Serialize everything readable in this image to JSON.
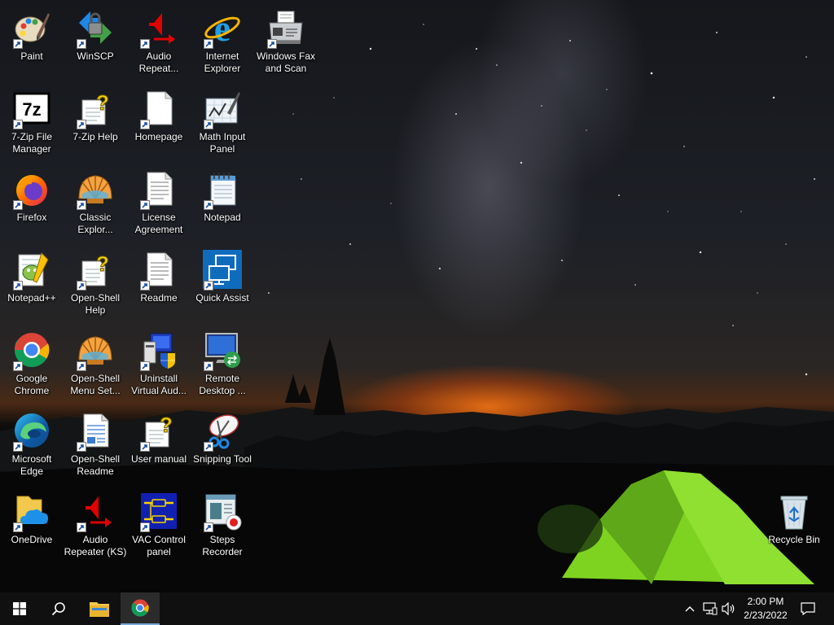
{
  "desktop": {
    "icons": [
      {
        "label": "Paint",
        "icon": "paint-icon"
      },
      {
        "label": "WinSCP",
        "icon": "winscp-icon"
      },
      {
        "label": "Audio Repeat...",
        "icon": "audio-repeater-icon"
      },
      {
        "label": "Internet Explorer",
        "icon": "internet-explorer-icon"
      },
      {
        "label": "Windows Fax and Scan",
        "icon": "fax-scan-icon"
      },
      {
        "label": "7-Zip File Manager",
        "icon": "7zip-icon"
      },
      {
        "label": "7-Zip Help",
        "icon": "help-file-icon"
      },
      {
        "label": "Homepage",
        "icon": "blank-document-icon"
      },
      {
        "label": "Math Input Panel",
        "icon": "math-input-icon"
      },
      {
        "label": "Firefox",
        "icon": "firefox-icon"
      },
      {
        "label": "Classic Explor...",
        "icon": "open-shell-icon"
      },
      {
        "label": "License Agreement",
        "icon": "text-document-icon"
      },
      {
        "label": "Notepad",
        "icon": "notepad-icon"
      },
      {
        "label": "Notepad++",
        "icon": "notepad-plus-plus-icon"
      },
      {
        "label": "Open-Shell Help",
        "icon": "help-file-icon"
      },
      {
        "label": "Readme",
        "icon": "text-document-icon"
      },
      {
        "label": "Quick Assist",
        "icon": "quick-assist-icon"
      },
      {
        "label": "Google Chrome",
        "icon": "chrome-icon"
      },
      {
        "label": "Open-Shell Menu Set...",
        "icon": "open-shell-icon"
      },
      {
        "label": "Uninstall Virtual Aud...",
        "icon": "uninstall-icon"
      },
      {
        "label": "Remote Desktop ...",
        "icon": "remote-desktop-icon"
      },
      {
        "label": "Microsoft Edge",
        "icon": "edge-icon"
      },
      {
        "label": "Open-Shell Readme",
        "icon": "rich-text-document-icon"
      },
      {
        "label": "User manual",
        "icon": "help-file-icon"
      },
      {
        "label": "Snipping Tool",
        "icon": "snipping-tool-icon"
      },
      {
        "label": "OneDrive",
        "icon": "onedrive-icon"
      },
      {
        "label": "Audio Repeater (KS)",
        "icon": "audio-repeater-icon"
      },
      {
        "label": "VAC Control panel",
        "icon": "vac-control-panel-icon"
      },
      {
        "label": "Steps Recorder",
        "icon": "steps-recorder-icon"
      },
      {
        "label": "Recycle Bin",
        "icon": "recycle-bin-icon"
      }
    ]
  },
  "taskbar": {
    "start_icon": "windows-logo-icon",
    "search_icon": "search-icon",
    "pinned": [
      "file-explorer-icon",
      "chrome-icon"
    ],
    "tray_icons": [
      "chevron-up-icon",
      "network-icon",
      "volume-icon"
    ],
    "clock": {
      "time": "2:00 PM",
      "date": "2/23/2022"
    },
    "notification_icon": "action-center-icon"
  },
  "colors": {
    "taskbar_bg": "#101010",
    "tent_green": "#7ed321",
    "horizon_orange": "#ff7a1a",
    "active_underline": "#78a8d8"
  }
}
